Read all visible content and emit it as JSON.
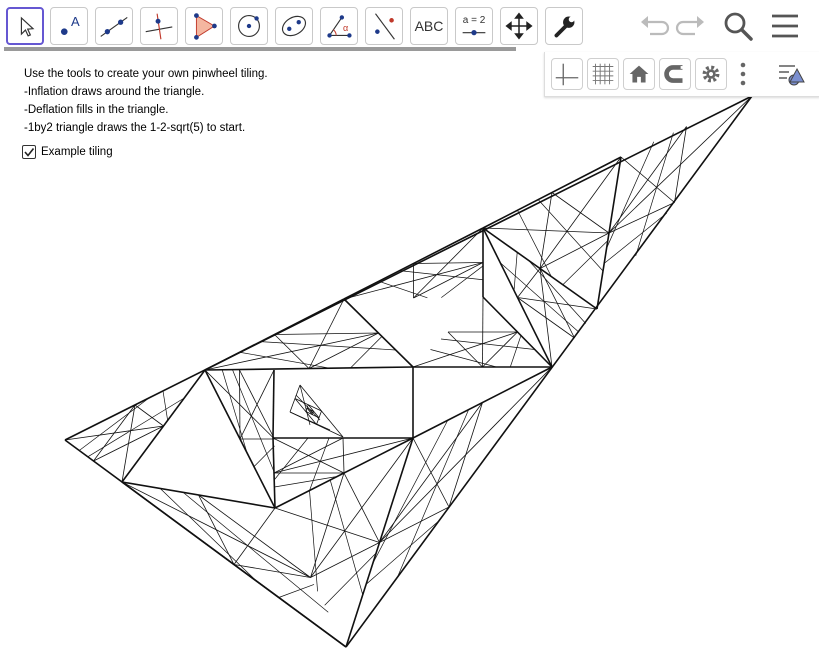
{
  "toolbar": {
    "tools": [
      {
        "name": "move-tool-button",
        "icon": "arrow-cursor-icon",
        "active": true
      },
      {
        "name": "point-tool-button",
        "icon": "point-icon",
        "label": "A"
      },
      {
        "name": "line-tool-button",
        "icon": "line-through-points-icon"
      },
      {
        "name": "perpendicular-line-tool-button",
        "icon": "perpendicular-line-icon"
      },
      {
        "name": "polygon-tool-button",
        "icon": "polygon-icon"
      },
      {
        "name": "circle-tool-button",
        "icon": "circle-with-center-icon"
      },
      {
        "name": "conic-tool-button",
        "icon": "ellipse-icon"
      },
      {
        "name": "angle-tool-button",
        "icon": "angle-icon",
        "label": "α"
      },
      {
        "name": "reflect-tool-button",
        "icon": "reflect-about-line-icon"
      },
      {
        "name": "text-tool-button",
        "icon": "text-icon",
        "label": "ABC"
      },
      {
        "name": "slider-tool-button",
        "icon": "slider-icon",
        "label": "a = 2"
      },
      {
        "name": "move-graphics-view-button",
        "icon": "move-view-icon"
      },
      {
        "name": "custom-tool-button",
        "icon": "wrench-icon"
      }
    ],
    "right": [
      "undo-icon",
      "redo-icon",
      "search-icon",
      "menu-icon"
    ]
  },
  "graphics_bar": [
    "axes-icon",
    "grid-icon",
    "home-icon",
    "magnet-icon",
    "gear-icon",
    "more-vertical-icon",
    "style-bar-icon"
  ],
  "instructions": [
    "Use the tools to create your own pinwheel tiling.",
    "-Inflation draws around the triangle.",
    "-Deflation fills in the triangle.",
    "-1by2 triangle draws the 1-2-sqrt(5) to start."
  ],
  "checkbox": {
    "label": "Example tiling",
    "checked": true
  },
  "colors": {
    "accent": "#6557d2",
    "point": "#1e3a8a",
    "polygon_fill": "#f4b6a0",
    "icon_gray": "#666666",
    "disabled": "#bbbbbb"
  }
}
